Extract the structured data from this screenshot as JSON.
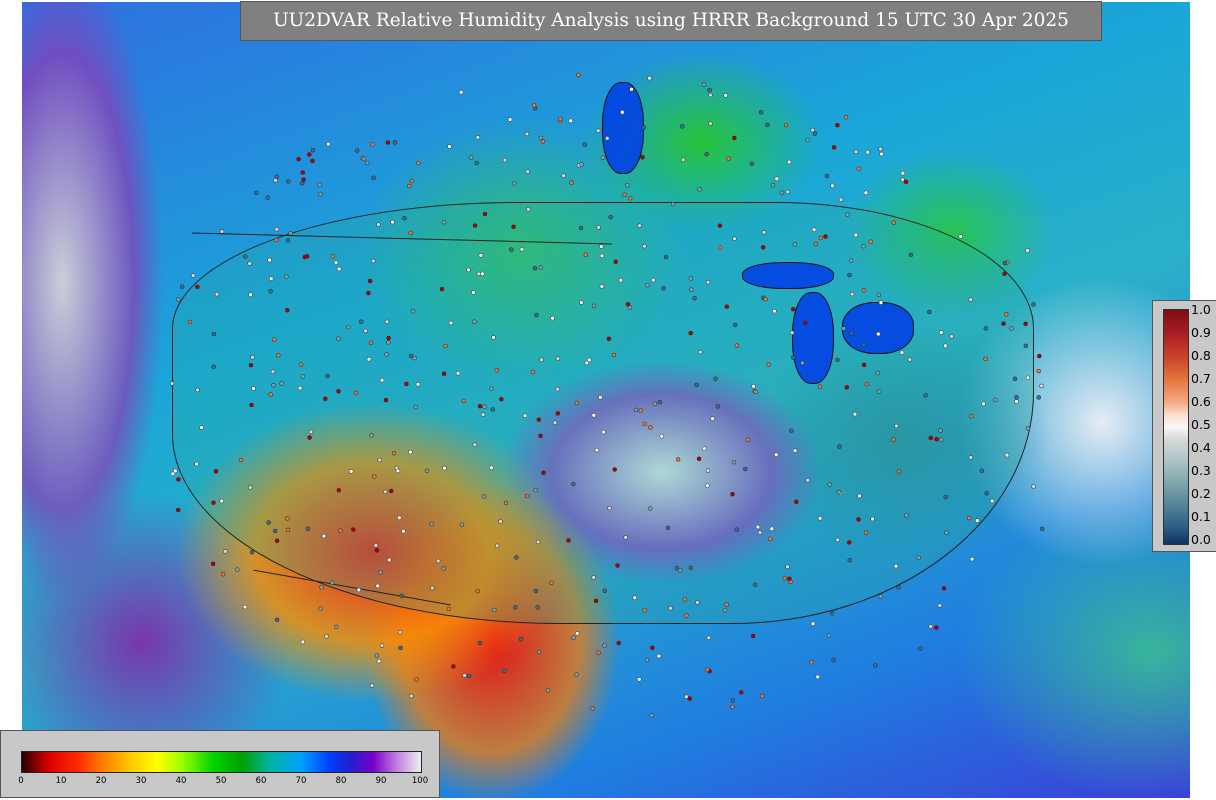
{
  "title": "UU2DVAR Relative Humidity Analysis using HRRR Background 15 UTC 30 Apr 2025",
  "innovation_legend": {
    "ticks": [
      "1.0",
      "0.9",
      "0.8",
      "0.7",
      "0.6",
      "0.5",
      "0.4",
      "0.3",
      "0.2",
      "0.1",
      "0.0"
    ]
  },
  "humidity_legend": {
    "ticks": [
      "0",
      "10",
      "20",
      "30",
      "40",
      "50",
      "60",
      "70",
      "80",
      "90",
      "100"
    ]
  }
}
